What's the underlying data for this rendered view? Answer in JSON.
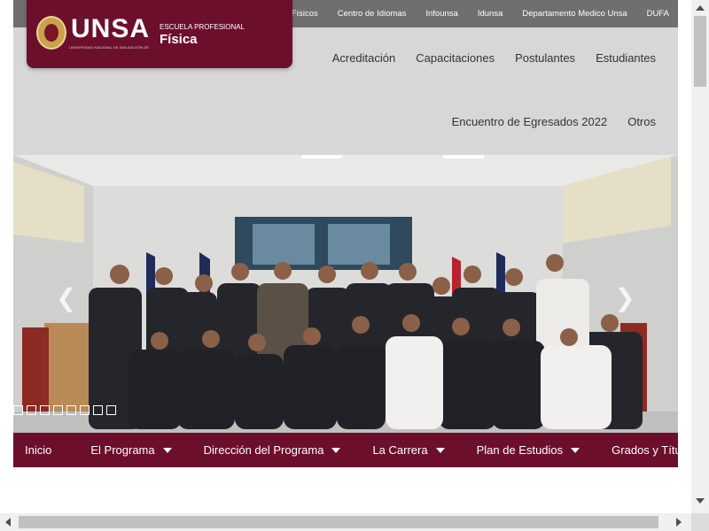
{
  "top_links": [
    "Colegio de Físicos",
    "Centro de Idiomas",
    "Infounsa",
    "Idunsa",
    "Departamento Medico Unsa",
    "DUFA"
  ],
  "logo": {
    "wordmark": "UNSA",
    "tagline": "UNIVERSIDAD NACIONAL DE SAN AGUSTÍN DE AREQUIPA",
    "school_label": "ESCUELA PROFESIONAL",
    "school_name": "Física"
  },
  "main_nav_row1": [
    "Acreditación",
    "Capacitaciones",
    "Postulantes",
    "Estudiantes"
  ],
  "main_nav_row2": [
    "Encuentro de Egresados 2022",
    "Otros"
  ],
  "hero": {
    "prev_symbol": "❮",
    "next_symbol": "❯",
    "slide_count": 9
  },
  "bottom_nav": [
    {
      "label": "Inicio",
      "dropdown": false
    },
    {
      "label": "El Programa",
      "dropdown": true
    },
    {
      "label": "Dirección del Programa",
      "dropdown": true
    },
    {
      "label": "La Carrera",
      "dropdown": true
    },
    {
      "label": "Plan de Estudios",
      "dropdown": true
    },
    {
      "label": "Grados y Títulos",
      "dropdown": false
    }
  ],
  "colors": {
    "brand": "#6c0f2a",
    "topbar": "#6f6f6f",
    "header_bg": "#d7d7d7"
  }
}
